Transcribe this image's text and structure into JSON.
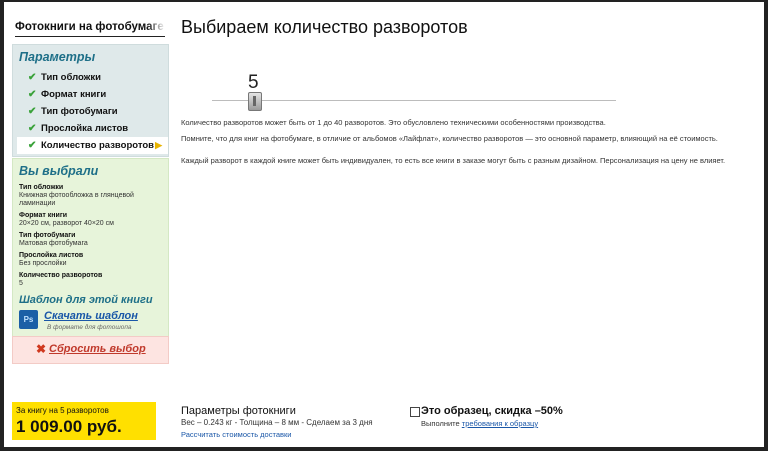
{
  "brand": "Фотокниги на фотобумаге",
  "sidebar": {
    "params_title": "Параметры",
    "items": [
      {
        "label": "Тип обложки"
      },
      {
        "label": "Формат книги"
      },
      {
        "label": "Тип фотобумаги"
      },
      {
        "label": "Прослойка листов"
      },
      {
        "label": "Количество разворотов"
      }
    ],
    "chosen_title": "Вы выбрали",
    "chosen": [
      {
        "key": "Тип обложки",
        "value": "Книжная фотообложка в глянцевой ламинации"
      },
      {
        "key": "Формат книги",
        "value": "20×20 см, разворот 40×20 см"
      },
      {
        "key": "Тип фотобумаги",
        "value": "Матовая фотобумага"
      },
      {
        "key": "Прослойка листов",
        "value": "Без прослойки"
      },
      {
        "key": "Количество разворотов",
        "value": "5"
      }
    ],
    "template_title": "Шаблон для этой книги",
    "template_icon": "Ps",
    "template_link": "Скачать шаблон",
    "template_sub": "В формате для фотошопа",
    "reset_label": "Сбросить выбор"
  },
  "price": {
    "label": "За книгу на 5 разворотов",
    "value": "1 009.00 руб."
  },
  "main": {
    "title": "Выбираем количество разворотов",
    "slider_value": "5",
    "info1": "Количество разворотов может быть от 1 до 40 разворотов. Это обусловлено техническими особенностями производства.",
    "info2": "Помните, что для книг на фотобумаге, в отличие от альбомов «Лайфлат», количество разворотов — это основной параметр, влияющий на её стоимость.",
    "info3": "Каждый разворот в каждой книге может быть индивидуален, то есть все книги в заказе могут быть с разным дизайном. Персонализация на цену не влияет."
  },
  "footer": {
    "params_title": "Параметры фотокниги",
    "params_line": "Вес – 0.243 кг - Толщина – 8 мм - Сделаем за 3 дня",
    "delivery_link": "Рассчитать стоимость доставки",
    "sample_title": "Это образец, скидка –50%",
    "sample_req_prefix": "Выполните",
    "sample_req_link": "требования к образцу"
  }
}
